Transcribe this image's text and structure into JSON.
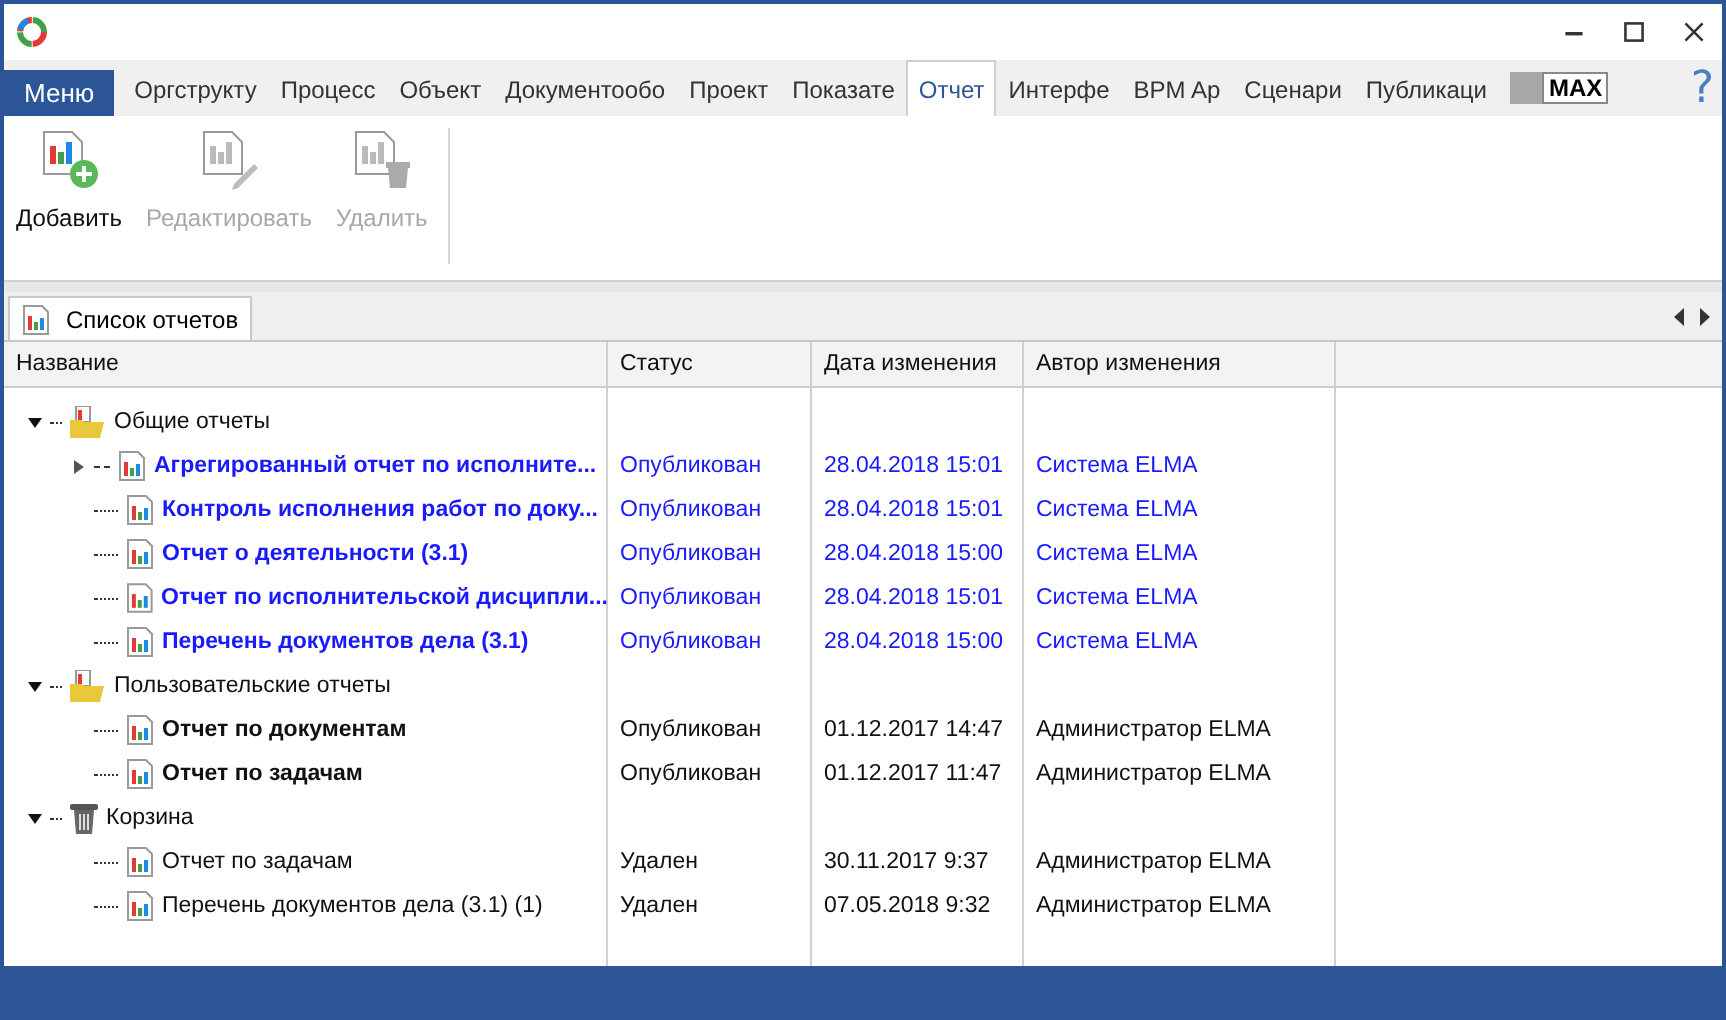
{
  "ribbon": {
    "menu": "Меню",
    "tabs": [
      {
        "label": "Оргструкту",
        "selected": false
      },
      {
        "label": "Процесс",
        "selected": false
      },
      {
        "label": "Объект",
        "selected": false
      },
      {
        "label": "Документообо",
        "selected": false
      },
      {
        "label": "Проект",
        "selected": false
      },
      {
        "label": "Показате",
        "selected": false
      },
      {
        "label": "Отчет",
        "selected": true
      },
      {
        "label": "Интерфе",
        "selected": false
      },
      {
        "label": "BPM Ap",
        "selected": false
      },
      {
        "label": "Сценари",
        "selected": false
      },
      {
        "label": "Публикаци",
        "selected": false
      }
    ],
    "max_label": "MAX",
    "help": "?"
  },
  "toolbar": [
    {
      "label": "Добавить",
      "kind": "add",
      "disabled": false
    },
    {
      "label": "Редактировать",
      "kind": "edit",
      "disabled": true
    },
    {
      "label": "Удалить",
      "kind": "delete",
      "disabled": true
    }
  ],
  "doc_tab": {
    "label": "Список отчетов"
  },
  "table": {
    "columns": [
      "Название",
      "Статус",
      "Дата изменения",
      "Автор изменения"
    ],
    "groups": [
      {
        "name": "Общие отчеты",
        "kind": "folder",
        "expanded": true,
        "children": [
          {
            "cells": [
              "Агрегированный отчет по исполните...",
              "Опубликован",
              "28.04.2018 15:01",
              "Система ELMA"
            ],
            "bold": true,
            "system": true,
            "has_children": true
          },
          {
            "cells": [
              "Контроль исполнения работ по доку...",
              "Опубликован",
              "28.04.2018 15:01",
              "Система ELMA"
            ],
            "bold": true,
            "system": true,
            "has_children": false
          },
          {
            "cells": [
              "Отчет о деятельности (3.1)",
              "Опубликован",
              "28.04.2018 15:00",
              "Система ELMA"
            ],
            "bold": true,
            "system": true,
            "has_children": false
          },
          {
            "cells": [
              "Отчет по исполнительской дисципли...",
              "Опубликован",
              "28.04.2018 15:01",
              "Система ELMA"
            ],
            "bold": true,
            "system": true,
            "has_children": false
          },
          {
            "cells": [
              "Перечень документов дела (3.1)",
              "Опубликован",
              "28.04.2018 15:00",
              "Система ELMA"
            ],
            "bold": true,
            "system": true,
            "has_children": false
          }
        ]
      },
      {
        "name": "Пользовательские отчеты",
        "kind": "folder",
        "expanded": true,
        "children": [
          {
            "cells": [
              "Отчет по документам",
              "Опубликован",
              "01.12.2017 14:47",
              "Администратор ELMA"
            ],
            "bold": true,
            "system": false,
            "has_children": false
          },
          {
            "cells": [
              "Отчет по задачам",
              "Опубликован",
              "01.12.2017 11:47",
              "Администратор ELMA"
            ],
            "bold": true,
            "system": false,
            "has_children": false
          }
        ]
      },
      {
        "name": "Корзина",
        "kind": "trash",
        "expanded": true,
        "children": [
          {
            "cells": [
              "Отчет по задачам",
              "Удален",
              "30.11.2017 9:37",
              "Администратор ELMA"
            ],
            "bold": false,
            "system": false,
            "has_children": false
          },
          {
            "cells": [
              "Перечень документов дела (3.1) (1)",
              "Удален",
              "07.05.2018 9:32",
              "Администратор ELMA"
            ],
            "bold": false,
            "system": false,
            "has_children": false
          }
        ]
      }
    ]
  }
}
